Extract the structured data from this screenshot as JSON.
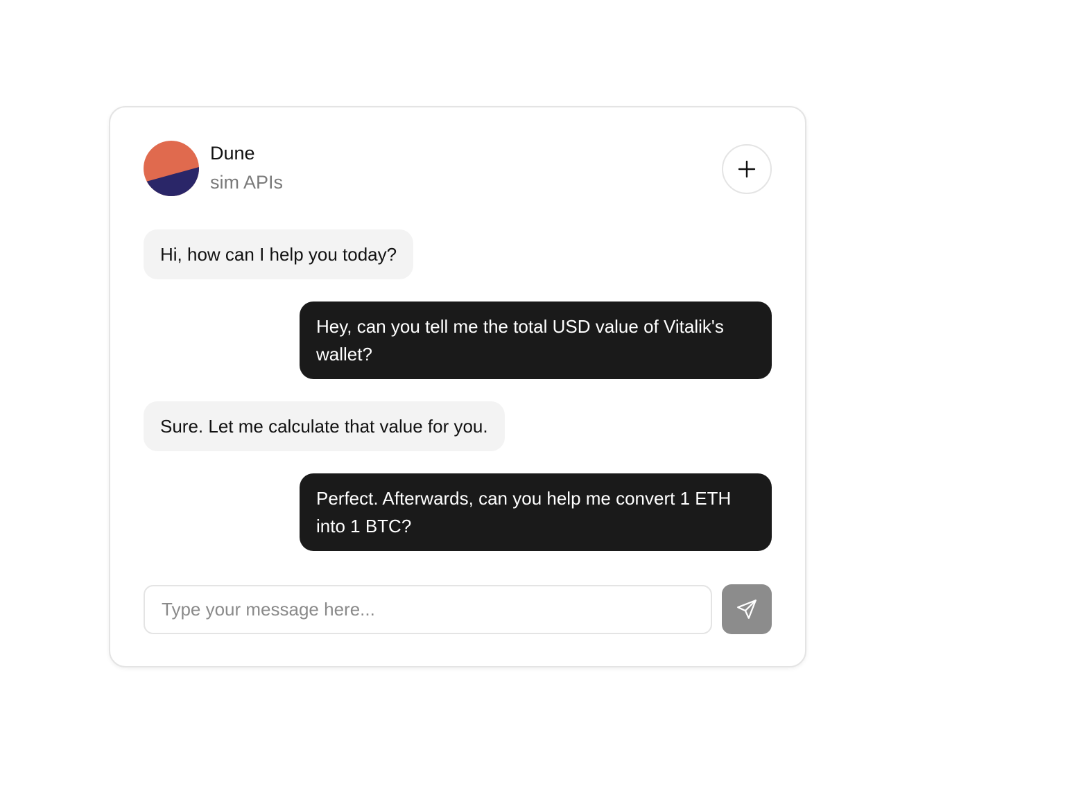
{
  "header": {
    "title": "Dune",
    "subtitle": "sim APIs",
    "avatar_colors": {
      "top": "#e06a4e",
      "bottom": "#2a2668"
    },
    "new_chat_icon": "plus-icon"
  },
  "messages": [
    {
      "role": "bot",
      "text": "Hi, how can I help you today?"
    },
    {
      "role": "user",
      "text": "Hey, can you tell me the total USD value of Vitalik's wallet?"
    },
    {
      "role": "bot",
      "text": "Sure. Let me calculate that value for you."
    },
    {
      "role": "user",
      "text": "Perfect. Afterwards, can you help me convert 1 ETH into 1 BTC?"
    }
  ],
  "composer": {
    "placeholder": "Type your message here...",
    "value": "",
    "send_icon": "send-icon"
  },
  "colors": {
    "user_bubble": "#1a1a1a",
    "bot_bubble": "#f3f3f3",
    "send_button": "#8c8c8c"
  }
}
